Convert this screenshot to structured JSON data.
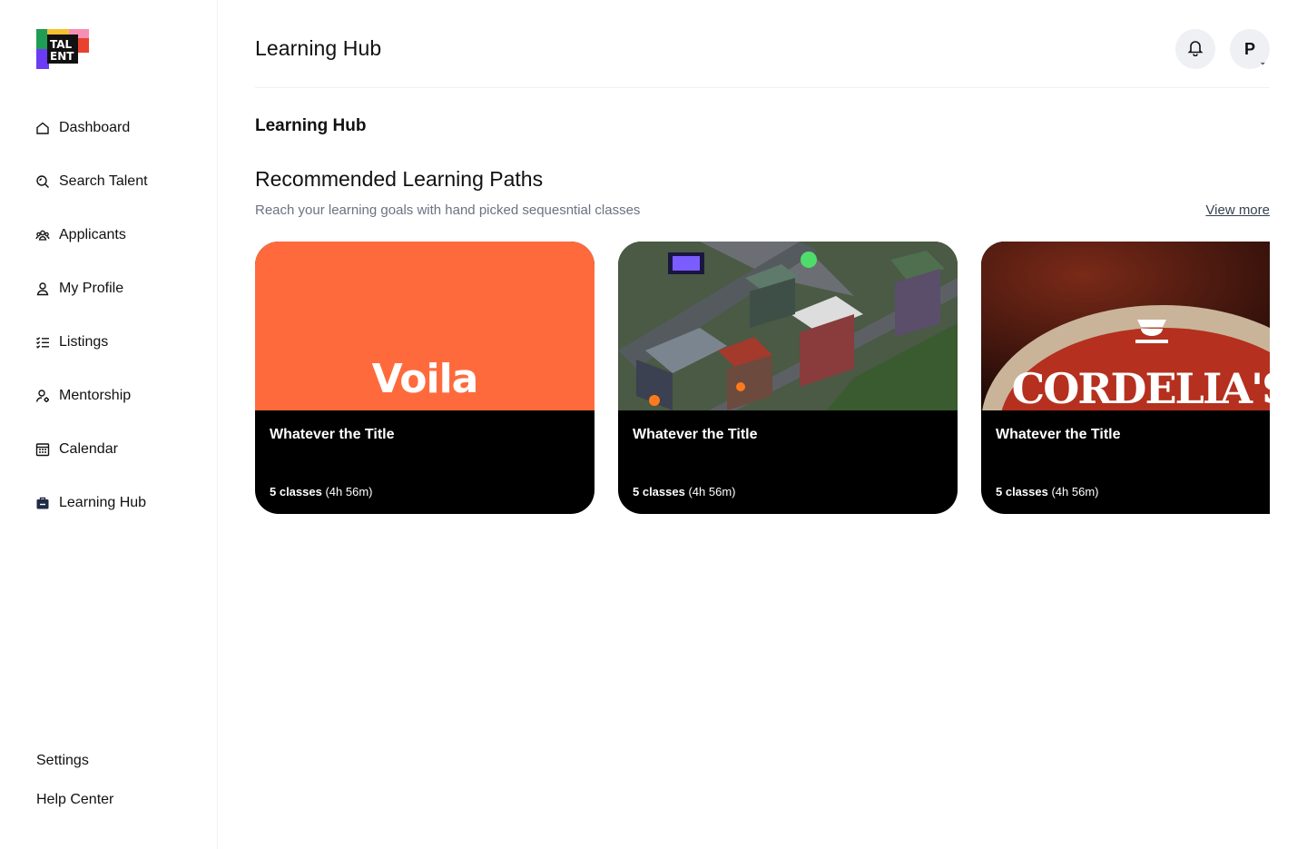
{
  "app": {
    "logo_text_line1": "TAL",
    "logo_text_line2": "ENT"
  },
  "sidebar": {
    "items": [
      {
        "label": "Dashboard",
        "icon": "home-icon"
      },
      {
        "label": "Search Talent",
        "icon": "search-icon"
      },
      {
        "label": "Applicants",
        "icon": "users-icon"
      },
      {
        "label": "My Profile",
        "icon": "user-icon"
      },
      {
        "label": "Listings",
        "icon": "list-icon"
      },
      {
        "label": "Mentorship",
        "icon": "user-settings-icon"
      },
      {
        "label": "Calendar",
        "icon": "calendar-icon"
      },
      {
        "label": "Learning Hub",
        "icon": "briefcase-icon",
        "active": true
      }
    ],
    "bottom": {
      "settings": "Settings",
      "help": "Help Center"
    }
  },
  "header": {
    "title": "Learning Hub",
    "avatar_initial": "P"
  },
  "main": {
    "page_title": "Learning Hub",
    "section_title": "Recommended Learning Paths",
    "section_subtitle": "Reach your learning goals with hand picked sequesntial classes",
    "view_more": "View more",
    "cards": [
      {
        "title": "Whatever the Title",
        "classes": "5 classes",
        "duration": "(4h 56m)",
        "brand": "Voila"
      },
      {
        "title": "Whatever the Title",
        "classes": "5 classes",
        "duration": "(4h 56m)"
      },
      {
        "title": "Whatever the Title",
        "classes": "5 classes",
        "duration": "(4h 56m)",
        "brand": "CORDELIA'S"
      }
    ]
  },
  "colors": {
    "accent_orange": "#FF6A3D",
    "card_bg": "#000000",
    "muted_text": "#6b7280"
  }
}
